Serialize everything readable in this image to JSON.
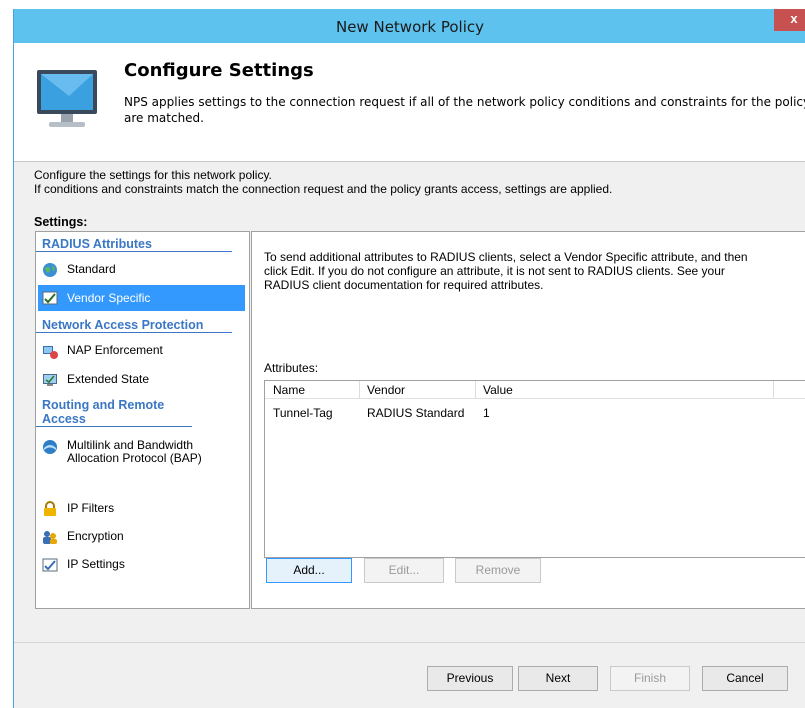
{
  "window": {
    "title": "New Network Policy",
    "close_label": "x"
  },
  "header": {
    "title": "Configure Settings",
    "description": "NPS applies settings to the connection request if all of the network policy conditions and constraints for the policy are matched."
  },
  "intro": {
    "line1": "Configure the settings for this network policy.",
    "line2": "If conditions and constraints match the connection request and the policy grants access, settings are applied."
  },
  "settings_label": "Settings:",
  "nav": {
    "group_radius": "RADIUS Attributes",
    "standard": "Standard",
    "vendor_specific": "Vendor Specific",
    "group_nap": "Network Access Protection",
    "nap_enforcement": "NAP Enforcement",
    "extended_state": "Extended State",
    "group_routing": "Routing and Remote Access",
    "multilink": "Multilink and Bandwidth Allocation Protocol (BAP)",
    "ip_filters": "IP Filters",
    "encryption": "Encryption",
    "ip_settings": "IP Settings"
  },
  "content": {
    "description": "To send additional attributes to RADIUS clients, select a Vendor Specific attribute, and then click Edit. If you do not configure an attribute, it is not sent to RADIUS clients. See your RADIUS client documentation for required attributes.",
    "attributes_label": "Attributes:",
    "columns": [
      "Name",
      "Vendor",
      "Value"
    ],
    "rows": [
      {
        "name": "Tunnel-Tag",
        "vendor": "RADIUS Standard",
        "value": "1"
      }
    ],
    "add_label": "Add...",
    "edit_label": "Edit...",
    "remove_label": "Remove"
  },
  "footer": {
    "previous_label": "Previous",
    "next_label": "Next",
    "finish_label": "Finish",
    "cancel_label": "Cancel"
  },
  "colors": {
    "titlebar": "#5ec2ee",
    "selection": "#3399ff",
    "group_text": "#3a77c5",
    "close": "#c75050"
  }
}
